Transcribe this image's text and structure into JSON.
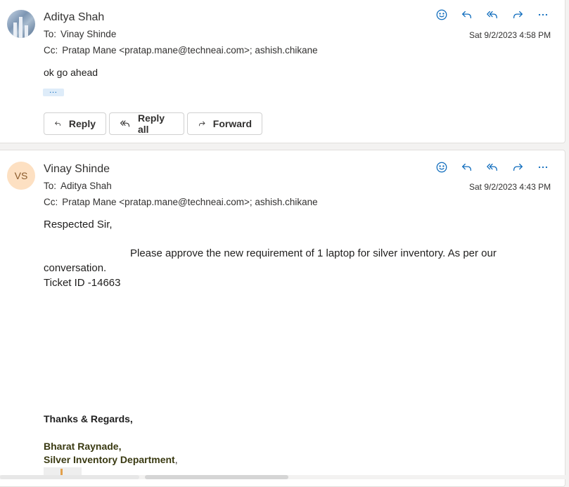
{
  "messages": [
    {
      "sender": "Aditya Shah",
      "to_label": "To:",
      "to": "Vinay Shinde",
      "cc_label": "Cc:",
      "cc": "Pratap Mane <pratap.mane@techneai.com>;  ashish.chikane",
      "date": "Sat 9/2/2023 4:58 PM",
      "body": "ok go ahead",
      "more_label": "…",
      "reply_label": "Reply",
      "reply_all_label": "Reply all",
      "forward_label": "Forward"
    },
    {
      "sender": "Vinay Shinde",
      "initials": "VS",
      "to_label": "To:",
      "to": "Aditya Shah",
      "cc_label": "Cc:",
      "cc": "Pratap Mane <pratap.mane@techneai.com>;  ashish.chikane",
      "date": "Sat 9/2/2023 4:43 PM",
      "greeting": "Respected Sir,",
      "body_line1": "Please approve the new requirement of 1 laptop for silver inventory. As per our",
      "body_line2": "conversation.",
      "ticket": "Ticket ID -14663",
      "signoff": "Thanks & Regards,",
      "sig_name": "Bharat Raynade,",
      "sig_dept": "Silver Inventory Department",
      "sig_dept_comma": ","
    }
  ],
  "icons": {
    "emoji": "smiley-icon",
    "reply": "reply-icon",
    "reply_all": "reply-all-icon",
    "forward": "forward-icon",
    "more": "more-icon"
  },
  "colors": {
    "accent": "#0f6cbd",
    "avatar_bg": "#fde0c2",
    "avatar_fg": "#8a5a2b",
    "signature_olive": "#3a3a12"
  }
}
